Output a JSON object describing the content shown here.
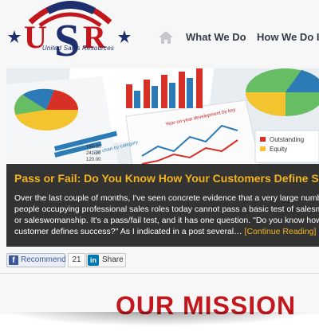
{
  "brand": {
    "logo_letters": "USR",
    "logo_tagline": "United Sales Resources",
    "colors": {
      "red": "#c2171d",
      "navy": "#1d2f6f"
    }
  },
  "nav": {
    "home_icon": "home-icon",
    "items": [
      {
        "label": "What We Do"
      },
      {
        "label": "How We Do It"
      }
    ]
  },
  "hero": {
    "chart_labels": {
      "column_title": "Year-on-year development by key",
      "category_title": "Bar chart by category",
      "legend_1": "Outstanding",
      "legend_2": "Equity",
      "values": [
        "148.30",
        "241.20",
        "120.00"
      ]
    },
    "post": {
      "title": "Pass or Fail: Do You Know How Your Customers Define Success?",
      "excerpt": "Over the last couple of months, I've seen concrete evidence that a very large number of people occupying professional sales roles today cannot pass a basic test of salesmanship or saleswomanship.  It's a pass/fail test, and it has one question. \"Do you know how your customer defines success?\"  As I indicated in a post several…",
      "more_link": "[Continue Reading]"
    }
  },
  "social": {
    "facebook_label": "Recommend",
    "facebook_count": "21",
    "linkedin_label": "Share"
  },
  "mission": {
    "heading": "OUR MISSION"
  }
}
